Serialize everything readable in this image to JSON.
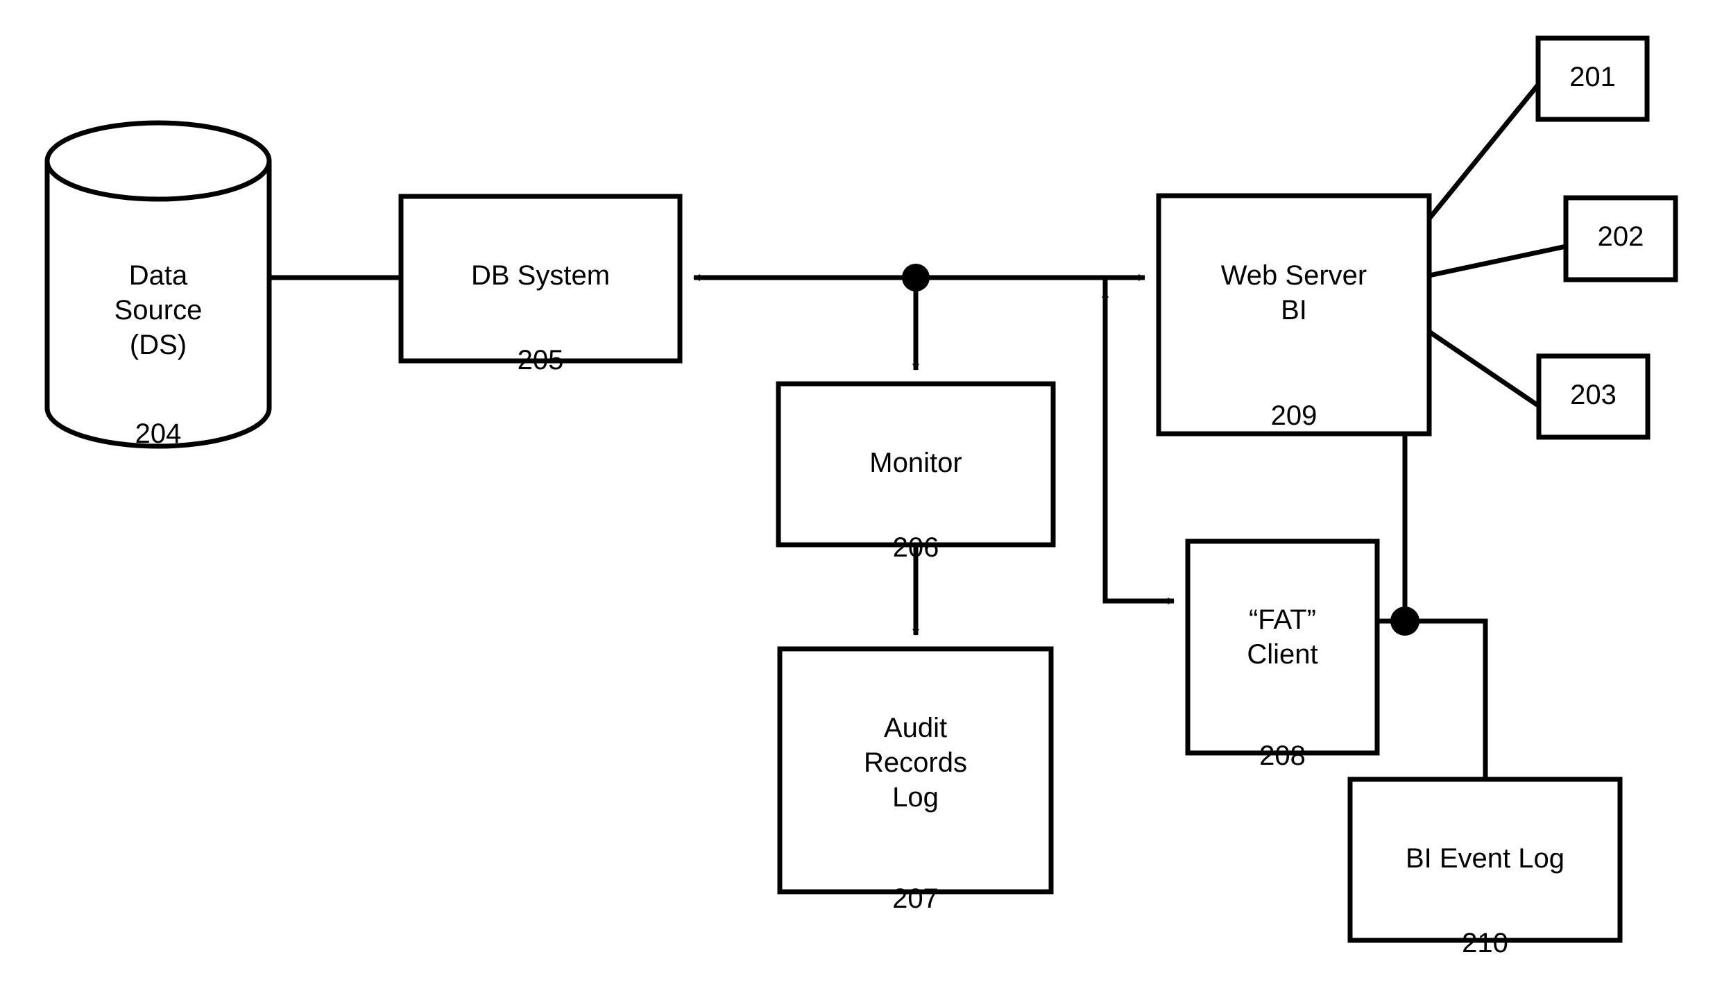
{
  "diagram": {
    "type": "patent-block-diagram",
    "stroke_color": "#000000",
    "background_color": "#ffffff",
    "nodes": [
      {
        "id": "data-source",
        "shape": "cylinder",
        "title": "Data\nSource\n(DS)",
        "ref": "204"
      },
      {
        "id": "db-system",
        "shape": "rectangle",
        "title": "DB System",
        "ref": "205"
      },
      {
        "id": "monitor",
        "shape": "rectangle",
        "title": "Monitor",
        "ref": "206"
      },
      {
        "id": "audit-records-log",
        "shape": "rectangle",
        "title": "Audit\nRecords\nLog",
        "ref": "207"
      },
      {
        "id": "web-server-bi",
        "shape": "rectangle",
        "title": "Web Server\nBI",
        "ref": "209"
      },
      {
        "id": "fat-client",
        "shape": "rectangle",
        "title": "“FAT”\nClient",
        "ref": "208"
      },
      {
        "id": "bi-event-log",
        "shape": "rectangle",
        "title": "BI Event Log",
        "ref": "210"
      }
    ],
    "reference_callouts": [
      {
        "id": "callout-201",
        "label": "201"
      },
      {
        "id": "callout-202",
        "label": "202"
      },
      {
        "id": "callout-203",
        "label": "203"
      }
    ],
    "connections": [
      {
        "from": "data-source",
        "to": "db-system",
        "style": "plain-line"
      },
      {
        "from": "db-system",
        "to": "web-server-bi",
        "style": "bidirectional-bus",
        "junction_dot": true
      },
      {
        "from": "junction",
        "to": "monitor",
        "style": "arrow-down"
      },
      {
        "from": "monitor",
        "to": "audit-records-log",
        "style": "arrow-down"
      },
      {
        "from": "db-system-bus",
        "to": "fat-client",
        "style": "arrow-right"
      },
      {
        "from": "fat-client-path",
        "to": "web-server-bi",
        "style": "arrow-up"
      },
      {
        "from": "web-server-bi",
        "to": "bi-event-log",
        "style": "plain-line",
        "junction_dot": true
      },
      {
        "from": "fat-client",
        "to": "bi-event-log-bus",
        "style": "plain-line"
      },
      {
        "from": "web-server-bi",
        "to": "callout-201",
        "style": "leader-line"
      },
      {
        "from": "web-server-bi",
        "to": "callout-202",
        "style": "leader-line"
      },
      {
        "from": "web-server-bi",
        "to": "callout-203",
        "style": "leader-line"
      }
    ]
  }
}
